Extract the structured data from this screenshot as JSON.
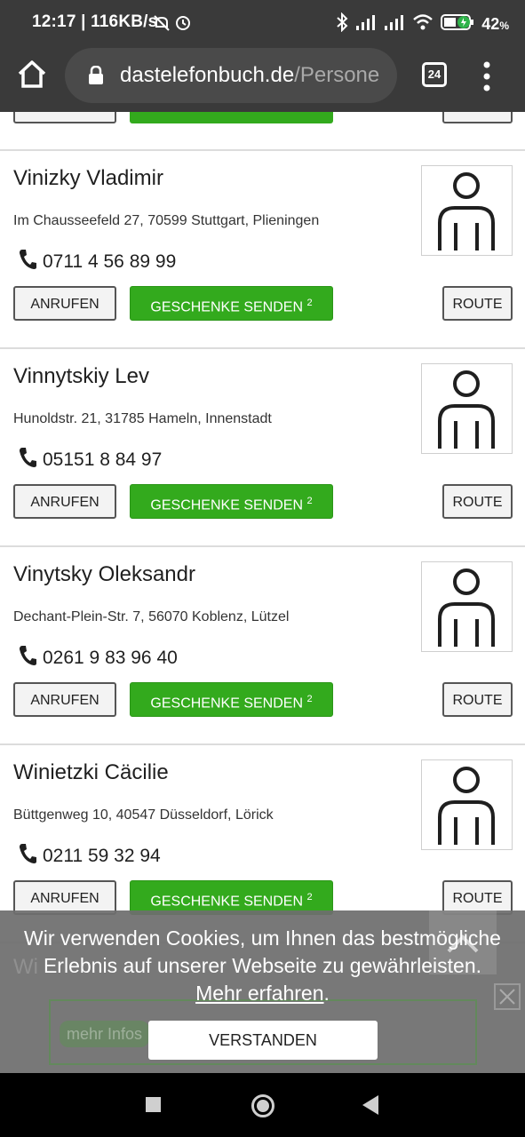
{
  "status_bar": {
    "time_speed": "12:17 | 116KB/s",
    "battery": "42",
    "battery_unit": "%"
  },
  "browser": {
    "url_host": "dastelefonbuch.de",
    "url_path": "/Persone",
    "tab_count": "24"
  },
  "entries": [
    {
      "name": "Vinizky Vladimir",
      "address": "Im Chausseefeld 27, 70599 Stuttgart, Plieningen",
      "phone": "0711 4 56 89 99"
    },
    {
      "name": "Vinnytskiy Lev",
      "address": "Hunoldstr. 21, 31785 Hameln, Innenstadt",
      "phone": "05151 8 84 97"
    },
    {
      "name": "Vinytsky Oleksandr",
      "address": "Dechant-Plein-Str. 7, 56070 Koblenz, Lützel",
      "phone": "0261 9 83 96 40"
    },
    {
      "name": "Winietzki Cäcilie",
      "address": "Büttgenweg 10, 40547 Düsseldorf, Lörick",
      "phone": "0211 59 32 94"
    }
  ],
  "buttons": {
    "call": "ANRUFEN",
    "gift": "GESCHENKE SENDEN",
    "gift_sup": "2",
    "route": "ROUTE"
  },
  "cookie": {
    "text": "Wir verwenden Cookies, um Ihnen das bestmögliche Erlebnis auf unserer Webseite zu gewährleisten.",
    "link": "Mehr erfahren",
    "period": ".",
    "accept": "VERSTANDEN",
    "ghost_ad_label": "mehr Infos",
    "ghost_name": "Wi"
  },
  "colors": {
    "accent_green": "#33aa1d",
    "bar_dark": "#3a3a3a"
  }
}
